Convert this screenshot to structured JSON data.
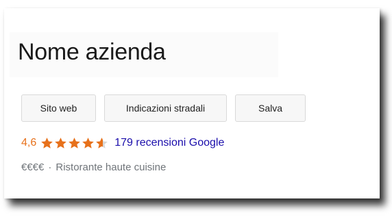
{
  "business": {
    "name": "Nome azienda"
  },
  "actions": {
    "website_label": "Sito web",
    "directions_label": "Indicazioni stradali",
    "save_label": "Salva"
  },
  "rating": {
    "value_text": "4,6",
    "value": 4.6,
    "max_stars": 5,
    "star_icon": "star-icon",
    "reviews_text": "179 recensioni Google"
  },
  "details": {
    "price_level": "€€€€",
    "separator": "·",
    "category": "Ristorante haute cuisine"
  },
  "colors": {
    "rating_orange": "#e7711b",
    "link_blue": "#1a0dab",
    "meta_gray": "#70757a"
  }
}
